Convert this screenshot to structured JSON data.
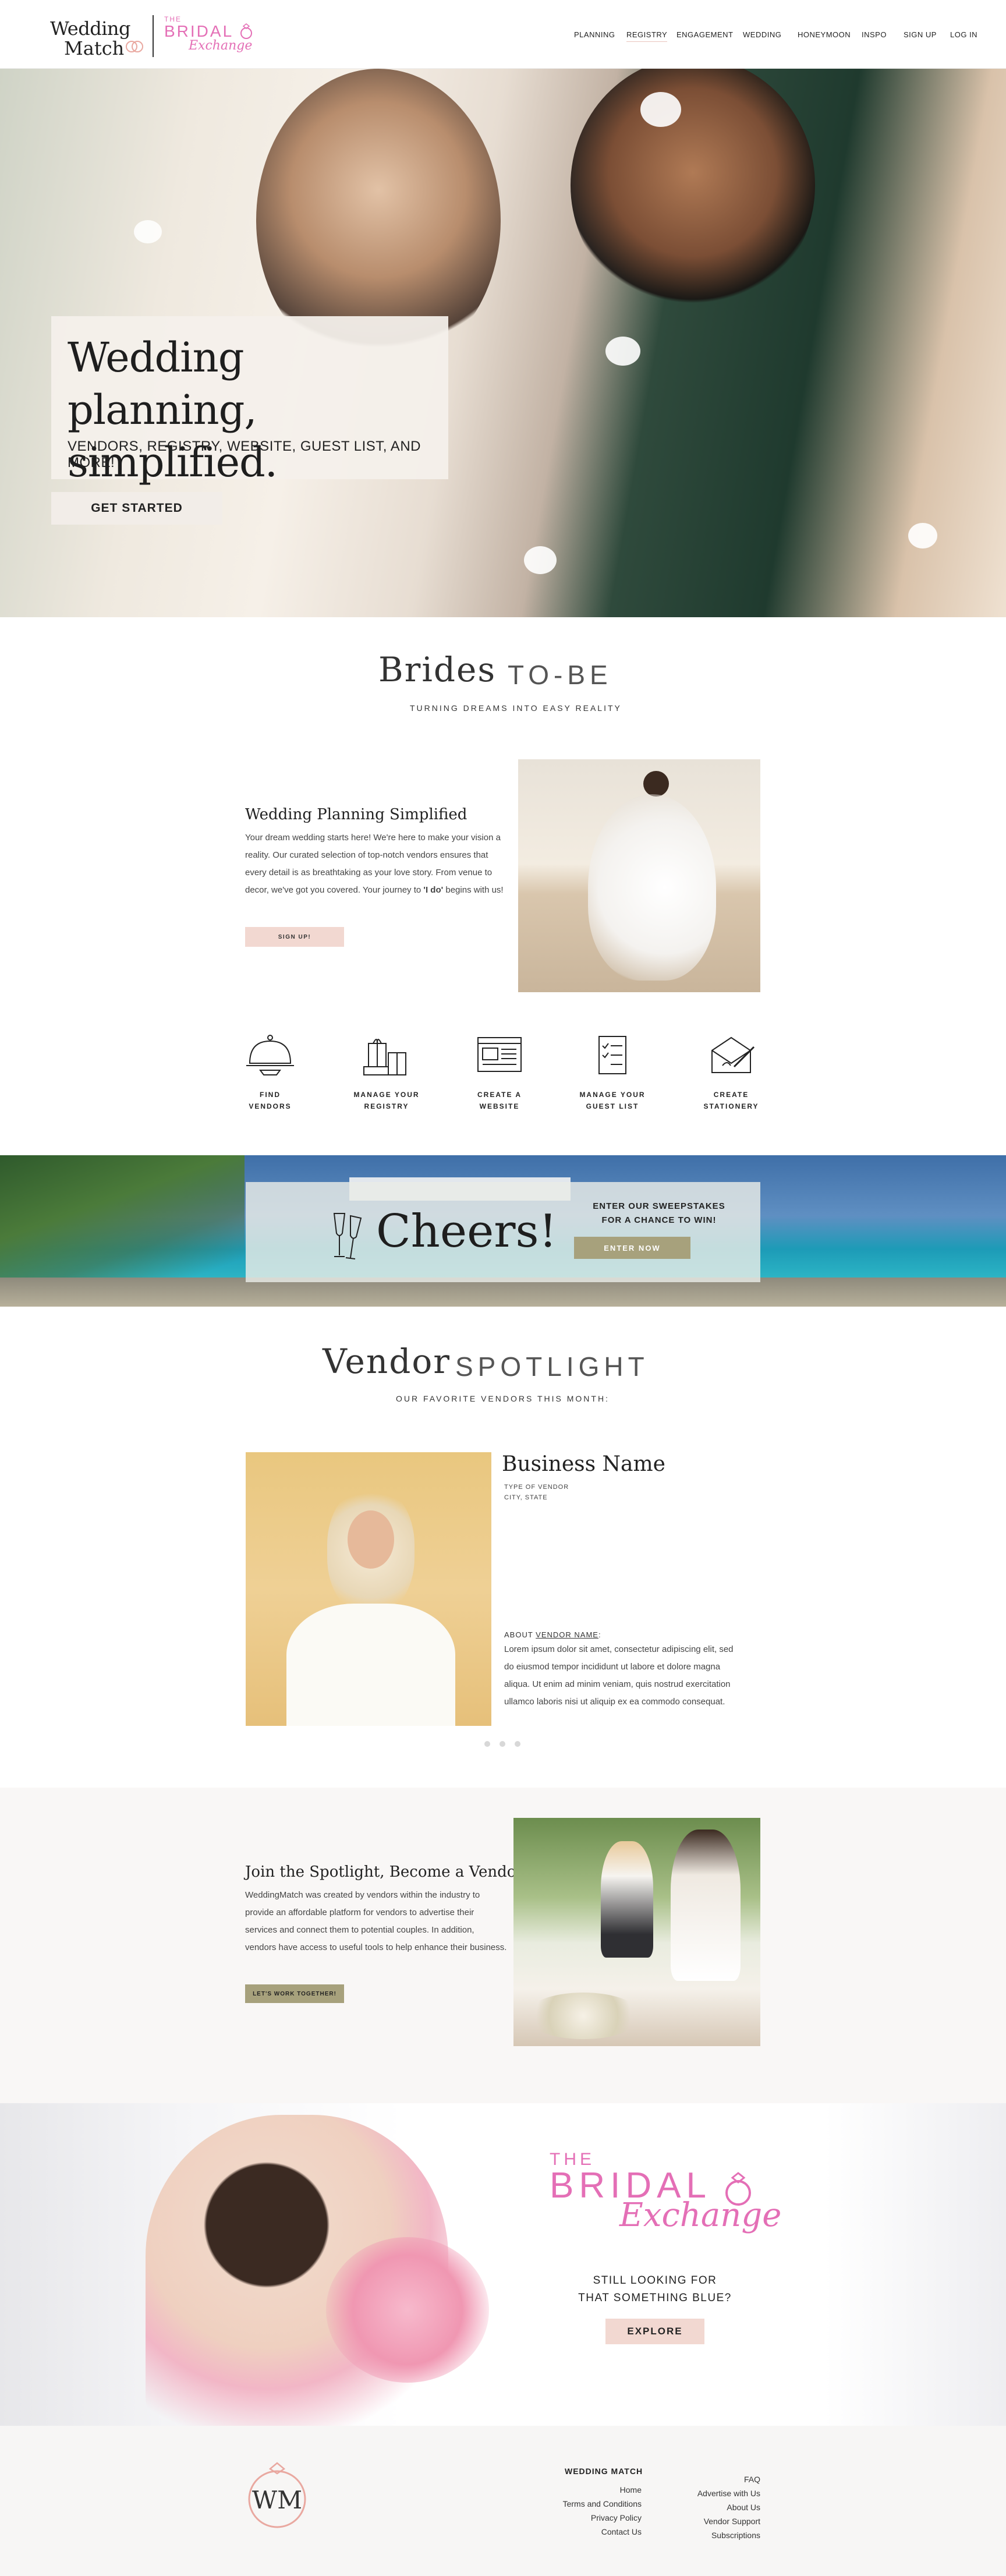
{
  "header": {
    "logo_wm_line1": "Wedding",
    "logo_wm_line2": "Match",
    "logo_be_the": "THE",
    "logo_be_bridal": "BRIDAL",
    "logo_be_exchange": "Exchange",
    "nav": [
      "PLANNING",
      "REGISTRY",
      "ENGAGEMENT",
      "WEDDING",
      "HONEYMOON",
      "INSPO",
      "SIGN UP",
      "LOG IN"
    ],
    "active_nav": "REGISTRY"
  },
  "hero": {
    "title": "Wedding planning, simplified.",
    "subtitle": "VENDORS, REGISTRY, WEBSITE, GUEST LIST, AND MORE!",
    "cta": "GET STARTED"
  },
  "brides": {
    "title_big": "Brides",
    "title_small": "TO-BE",
    "subtitle": "TURNING DREAMS INTO EASY REALITY",
    "heading": "Wedding Planning Simplified",
    "body_before": "Your dream wedding starts here!  We're here to make your vision a reality. Our curated selection of top-notch vendors ensures that every detail is as breathtaking as your love story. From venue to decor, we've got you covered. Your journey to ",
    "body_bold": "'I do'",
    "body_after": " begins with us!",
    "cta": "SIGN UP!"
  },
  "features": [
    {
      "line1": "FIND",
      "line2": "VENDORS",
      "icon": "cloche-icon"
    },
    {
      "line1": "MANAGE YOUR",
      "line2": "REGISTRY",
      "icon": "gifts-icon"
    },
    {
      "line1": "CREATE A",
      "line2": "WEBSITE",
      "icon": "website-icon"
    },
    {
      "line1": "MANAGE YOUR",
      "line2": "GUEST LIST",
      "icon": "checklist-icon"
    },
    {
      "line1": "CREATE",
      "line2": "STATIONERY",
      "icon": "envelope-pen-icon"
    }
  ],
  "cheers": {
    "word": "Cheers!",
    "line1": "ENTER OUR SWEEPSTAKES",
    "line2": "FOR A CHANCE TO WIN!",
    "cta": "ENTER NOW"
  },
  "vendor": {
    "title_big": "Vendor",
    "title_small": "SPOTLIGHT",
    "subtitle": "OUR FAVORITE VENDORS THIS MONTH:",
    "business_name": "Business Name",
    "type": "TYPE OF VENDOR",
    "location": "CITY, STATE",
    "about_label": "ABOUT ",
    "about_name": "VENDOR NAME",
    "about_colon": ":",
    "about_text": "Lorem ipsum dolor sit amet, consectetur adipiscing elit, sed do eiusmod tempor incididunt ut labore et dolore magna aliqua. Ut enim ad minim veniam, quis nostrud exercitation ullamco laboris nisi ut aliquip ex ea commodo consequat."
  },
  "join": {
    "heading": "Join the Spotlight, Become a Vendor!",
    "body": "WeddingMatch was created by vendors within the industry to provide an affordable platform for vendors to advertise their services and connect them to potential couples. In addition, vendors have access to useful tools to help enhance their business.",
    "cta": "LET'S WORK TOGETHER!"
  },
  "bridal_exchange": {
    "the": "THE",
    "bridal": "BRIDAL",
    "exchange": "Exchange",
    "line1": "STILL LOOKING FOR",
    "line2": "THAT SOMETHING BLUE?",
    "cta": "EXPLORE"
  },
  "footer": {
    "monogram": "WM",
    "heading": "WEDDING MATCH",
    "col1": [
      "Home",
      "Terms and Conditions",
      "Privacy Policy",
      "Contact Us"
    ],
    "col2": [
      "FAQ",
      "Advertise with Us",
      "About Us",
      "Vendor Support",
      "Subscriptions"
    ]
  },
  "colors": {
    "brand_pink": "#e46fb6",
    "blush": "#f2d8d1",
    "olive": "#a7a17c"
  }
}
